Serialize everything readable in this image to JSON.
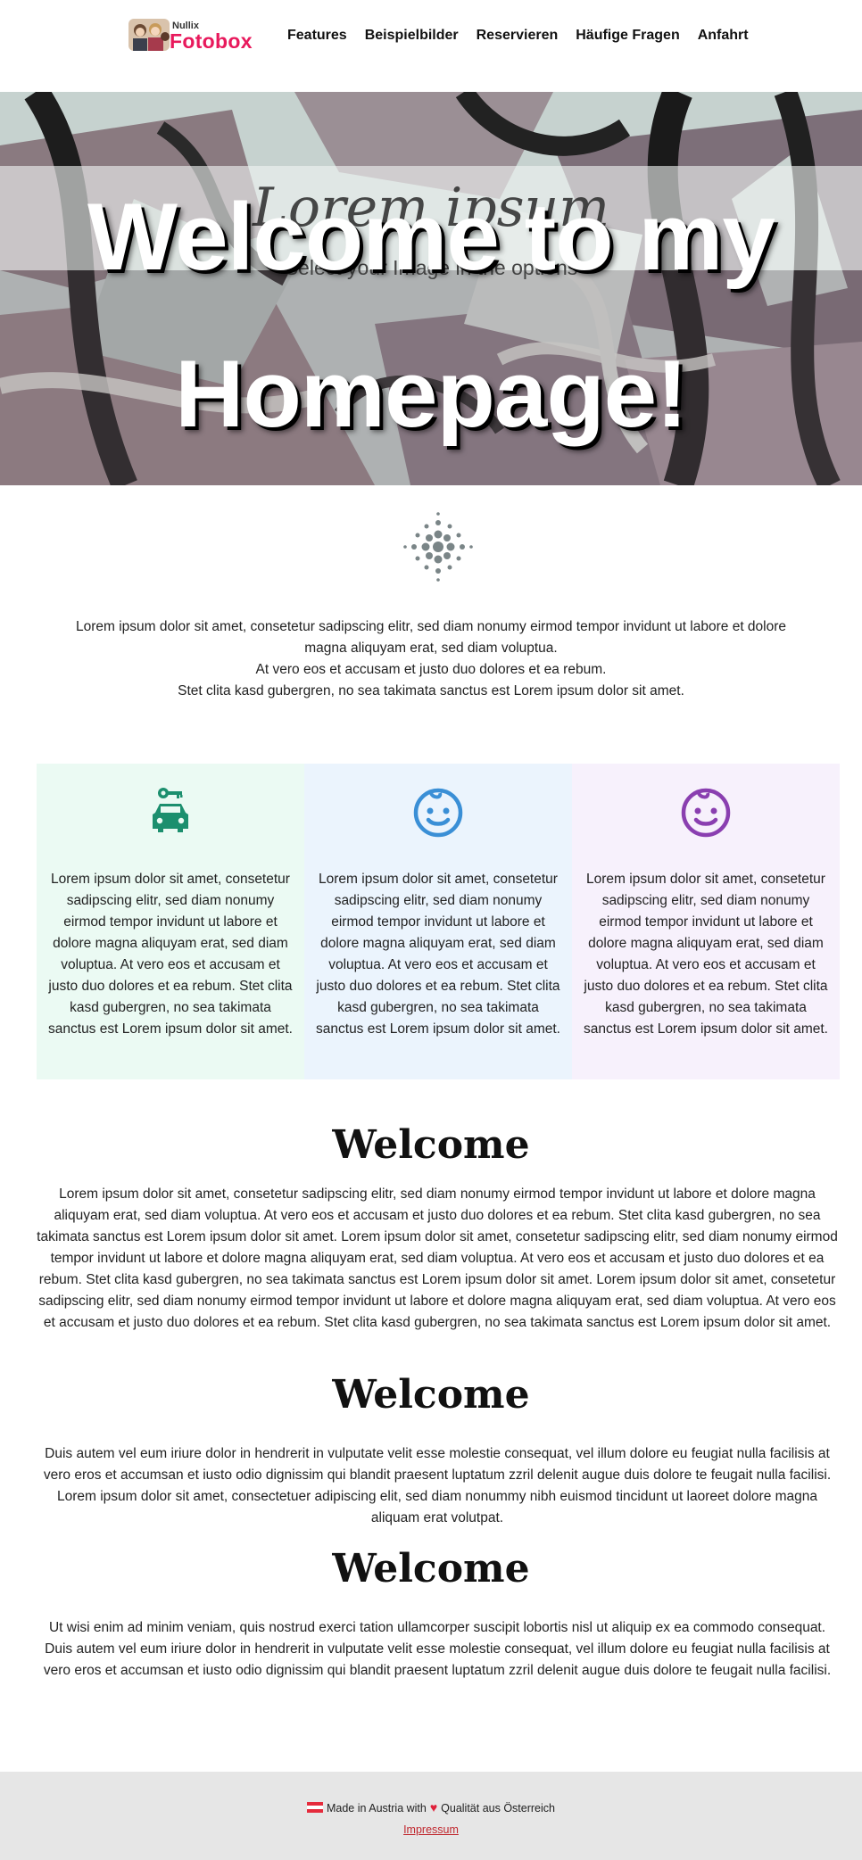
{
  "header": {
    "logo_small": "Nullix",
    "logo_big": "Fotobox",
    "nav": [
      "Features",
      "Beispielbilder",
      "Reservieren",
      "Häufige Fragen",
      "Anfahrt"
    ]
  },
  "hero": {
    "script_text": "Lorem ipsum",
    "subtitle": "Select your Image in the options",
    "title": "Welcome to my Homepage!"
  },
  "intro": {
    "lines": [
      "Lorem ipsum dolor sit amet, consetetur sadipscing elitr, sed diam nonumy eirmod tempor invidunt ut labore et dolore magna aliquyam erat, sed diam voluptua.",
      "At vero eos et accusam et justo duo dolores et ea rebum.",
      "Stet clita kasd gubergren, no sea takimata sanctus est Lorem ipsum dolor sit amet."
    ]
  },
  "features": [
    {
      "icon": "car-key-icon",
      "color": "#1c8f6e",
      "bg": "#ebfaf3",
      "text": "Lorem ipsum dolor sit amet, consetetur sadipscing elitr, sed diam nonumy eirmod tempor invidunt ut labore et dolore magna aliquyam erat, sed diam voluptua. At vero eos et accusam et justo duo dolores et ea rebum. Stet clita kasd gubergren, no sea takimata sanctus est Lorem ipsum dolor sit amet."
    },
    {
      "icon": "baby-face-icon",
      "color": "#3a8fd6",
      "bg": "#ebf4fd",
      "text": "Lorem ipsum dolor sit amet, consetetur sadipscing elitr, sed diam nonumy eirmod tempor invidunt ut labore et dolore magna aliquyam erat, sed diam voluptua. At vero eos et accusam et justo duo dolores et ea rebum. Stet clita kasd gubergren, no sea takimata sanctus est Lorem ipsum dolor sit amet."
    },
    {
      "icon": "baby-face-icon",
      "color": "#8a3fb0",
      "bg": "#f7f1fc",
      "text": "Lorem ipsum dolor sit amet, consetetur sadipscing elitr, sed diam nonumy eirmod tempor invidunt ut labore et dolore magna aliquyam erat, sed diam voluptua. At vero eos et accusam et justo duo dolores et ea rebum. Stet clita kasd gubergren, no sea takimata sanctus est Lorem ipsum dolor sit amet."
    }
  ],
  "sections": [
    {
      "title": "Welcome",
      "text": "Lorem ipsum dolor sit amet, consetetur sadipscing elitr, sed diam nonumy eirmod tempor invidunt ut labore et dolore magna aliquyam erat, sed diam voluptua. At vero eos et accusam et justo duo dolores et ea rebum. Stet clita kasd gubergren, no sea takimata sanctus est Lorem ipsum dolor sit amet. Lorem ipsum dolor sit amet, consetetur sadipscing elitr, sed diam nonumy eirmod tempor invidunt ut labore et dolore magna aliquyam erat, sed diam voluptua. At vero eos et accusam et justo duo dolores et ea rebum. Stet clita kasd gubergren, no sea takimata sanctus est Lorem ipsum dolor sit amet. Lorem ipsum dolor sit amet, consetetur sadipscing elitr, sed diam nonumy eirmod tempor invidunt ut labore et dolore magna aliquyam erat, sed diam voluptua. At vero eos et accusam et justo duo dolores et ea rebum. Stet clita kasd gubergren, no sea takimata sanctus est Lorem ipsum dolor sit amet."
    },
    {
      "title": "Welcome",
      "text": "Duis autem vel eum iriure dolor in hendrerit in vulputate velit esse molestie consequat, vel illum dolore eu feugiat nulla facilisis at vero eros et accumsan et iusto odio dignissim qui blandit praesent luptatum zzril delenit augue duis dolore te feugait nulla facilisi. Lorem ipsum dolor sit amet, consectetuer adipiscing elit, sed diam nonummy nibh euismod tincidunt ut laoreet dolore magna aliquam erat volutpat."
    },
    {
      "title": "Welcome",
      "text": "Ut wisi enim ad minim veniam, quis nostrud exerci tation ullamcorper suscipit lobortis nisl ut aliquip ex ea commodo consequat. Duis autem vel eum iriure dolor in hendrerit in vulputate velit esse molestie consequat, vel illum dolore eu feugiat nulla facilisis at vero eros et accumsan et iusto odio dignissim qui blandit praesent luptatum zzril delenit augue duis dolore te feugait nulla facilisi."
    }
  ],
  "footer": {
    "made_in": "Made in Austria with",
    "quality": "Qualität aus Österreich",
    "impressum": "Impressum"
  }
}
